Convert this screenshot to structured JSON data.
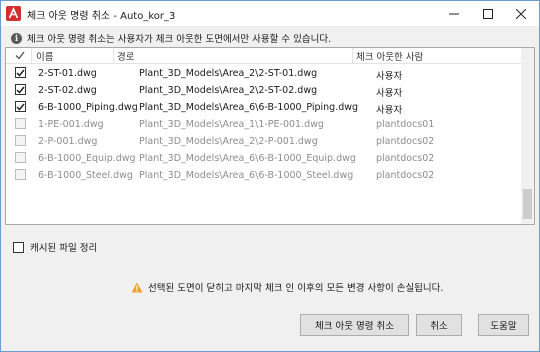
{
  "window": {
    "title": "체크 아웃 명령 취소 - Auto_kor_3",
    "icon": "autodesk-a-icon",
    "accent": "#d32f2f"
  },
  "info_text": "체크 아웃 명령 취소는 사용자가 체크 아웃한 도면에서만 사용할 수 있습니다.",
  "table": {
    "columns": [
      "이름",
      "경로",
      "체크 아웃한 사람"
    ],
    "rows": [
      {
        "checked": true,
        "enabled": true,
        "name": "2-ST-01.dwg",
        "path": "Plant_3D_Models\\Area_2\\2-ST-01.dwg",
        "owner": "사용자"
      },
      {
        "checked": true,
        "enabled": true,
        "name": "2-ST-02.dwg",
        "path": "Plant_3D_Models\\Area_2\\2-ST-02.dwg",
        "owner": "사용자"
      },
      {
        "checked": true,
        "enabled": true,
        "name": "6-B-1000_Piping.dwg",
        "path": "Plant_3D_Models\\Area_6\\6-B-1000_Piping.dwg",
        "owner": "사용자"
      },
      {
        "checked": false,
        "enabled": false,
        "name": "1-PE-001.dwg",
        "path": "Plant_3D_Models\\Area_1\\1-PE-001.dwg",
        "owner": "plantdocs01"
      },
      {
        "checked": false,
        "enabled": false,
        "name": "2-P-001.dwg",
        "path": "Plant_3D_Models\\Area_2\\2-P-001.dwg",
        "owner": "plantdocs02"
      },
      {
        "checked": false,
        "enabled": false,
        "name": "6-B-1000_Equip.dwg",
        "path": "Plant_3D_Models\\Area_6\\6-B-1000_Equip.dwg",
        "owner": "plantdocs02"
      },
      {
        "checked": false,
        "enabled": false,
        "name": "6-B-1000_Steel.dwg",
        "path": "Plant_3D_Models\\Area_6\\6-B-1000_Steel.dwg",
        "owner": "plantdocs02"
      }
    ]
  },
  "cache_checkbox": {
    "label": "캐시된 파일 정리",
    "checked": false
  },
  "warning_text": "선택된 도면이 닫히고 마지막 체크 인 이후의 모든 변경 사항이 손실됩니다.",
  "buttons": {
    "undo_checkout": "체크 아웃 명령 취소",
    "cancel": "취소",
    "help": "도움말"
  }
}
